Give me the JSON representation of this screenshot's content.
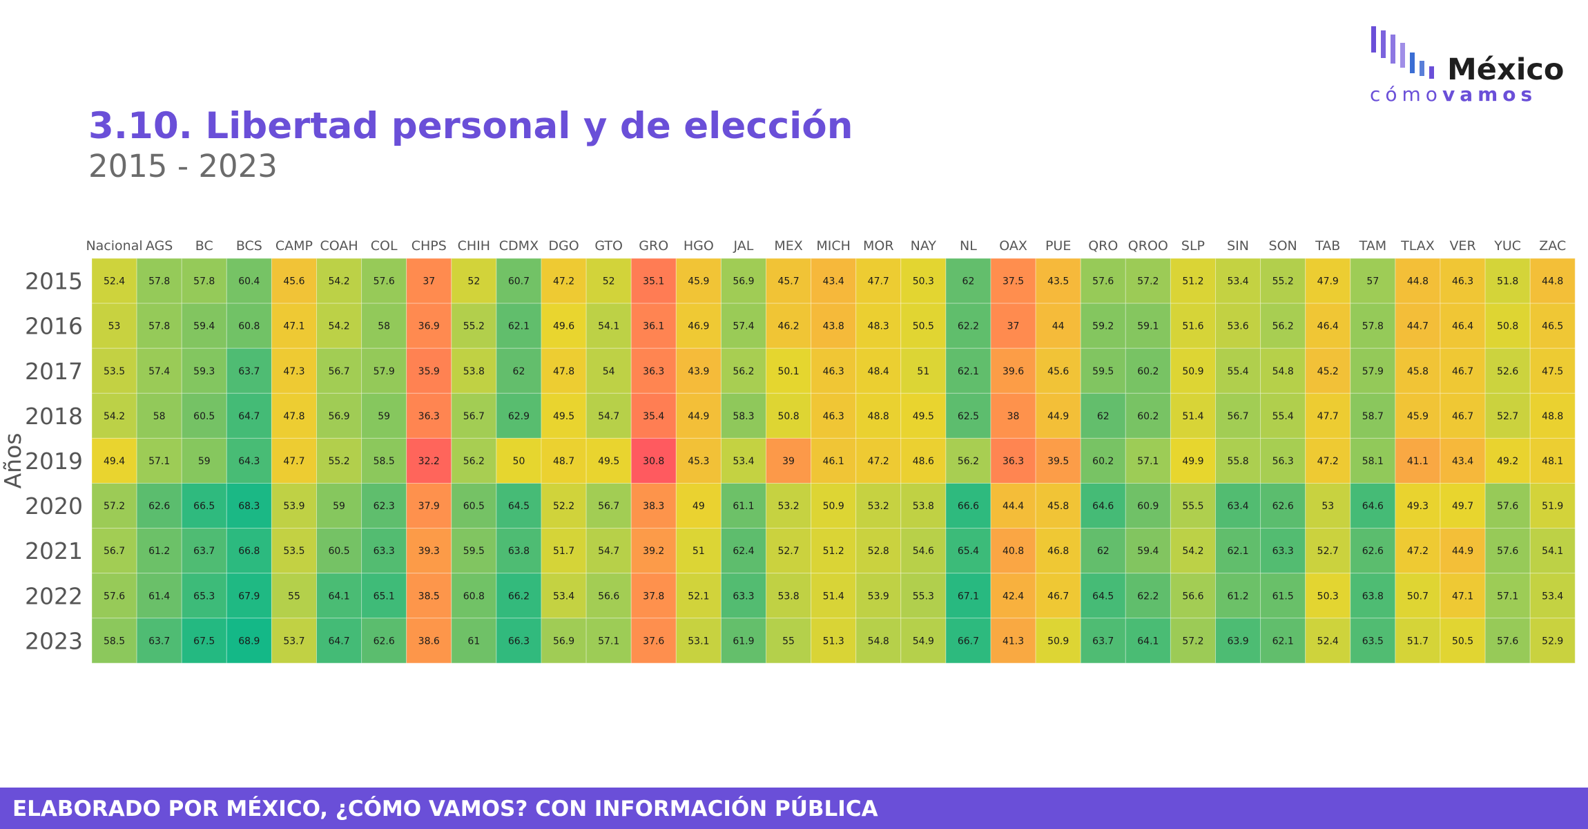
{
  "header": {
    "title": "3.10. Libertad personal y de elección",
    "subtitle": "2015 - 2023"
  },
  "logo": {
    "word": "México",
    "sub_light": "cómo",
    "sub_bold": "vamos",
    "bar_colors": [
      "#6a4fd8",
      "#7b63dd",
      "#8d78e2",
      "#a08ee7",
      "#3b6ed4",
      "#5a7fd8"
    ]
  },
  "footer": {
    "text": "ELABORADO POR MÉXICO, ¿CÓMO VAMOS? CON INFORMACIÓN PÚBLICA",
    "color": "#6a4fd8"
  },
  "chart_data": {
    "type": "heatmap",
    "title": "3.10. Libertad personal y de elección",
    "subtitle": "2015 - 2023",
    "ylabel": "Años",
    "xlabel": "",
    "x": [
      "Nacional",
      "AGS",
      "BC",
      "BCS",
      "CAMP",
      "COAH",
      "COL",
      "CHPS",
      "CHIH",
      "CDMX",
      "DGO",
      "GTO",
      "GRO",
      "HGO",
      "JAL",
      "MEX",
      "MICH",
      "MOR",
      "NAY",
      "NL",
      "OAX",
      "PUE",
      "QRO",
      "QROO",
      "SLP",
      "SIN",
      "SON",
      "TAB",
      "TAM",
      "TLAX",
      "VER",
      "YUC",
      "ZAC"
    ],
    "y": [
      "2015",
      "2016",
      "2017",
      "2018",
      "2019",
      "2020",
      "2021",
      "2022",
      "2023"
    ],
    "values": [
      [
        "52.4",
        "57.8",
        "57.8",
        "60.4",
        "45.6",
        "54.2",
        "57.6",
        "37",
        "52",
        "60.7",
        "47.2",
        "52",
        "35.1",
        "45.9",
        "56.9",
        "45.7",
        "43.4",
        "47.7",
        "50.3",
        "62",
        "37.5",
        "43.5",
        "57.6",
        "57.2",
        "51.2",
        "53.4",
        "55.2",
        "47.9",
        "57",
        "44.8",
        "46.3",
        "51.8",
        "44.8"
      ],
      [
        "53",
        "57.8",
        "59.4",
        "60.8",
        "47.1",
        "54.2",
        "58",
        "36.9",
        "55.2",
        "62.1",
        "49.6",
        "54.1",
        "36.1",
        "46.9",
        "57.4",
        "46.2",
        "43.8",
        "48.3",
        "50.5",
        "62.2",
        "37",
        "44",
        "59.2",
        "59.1",
        "51.6",
        "53.6",
        "56.2",
        "46.4",
        "57.8",
        "44.7",
        "46.4",
        "50.8",
        "46.5"
      ],
      [
        "53.5",
        "57.4",
        "59.3",
        "63.7",
        "47.3",
        "56.7",
        "57.9",
        "35.9",
        "53.8",
        "62",
        "47.8",
        "54",
        "36.3",
        "43.9",
        "56.2",
        "50.1",
        "46.3",
        "48.4",
        "51",
        "62.1",
        "39.6",
        "45.6",
        "59.5",
        "60.2",
        "50.9",
        "55.4",
        "54.8",
        "45.2",
        "57.9",
        "45.8",
        "46.7",
        "52.6",
        "47.5"
      ],
      [
        "54.2",
        "58",
        "60.5",
        "64.7",
        "47.8",
        "56.9",
        "59",
        "36.3",
        "56.7",
        "62.9",
        "49.5",
        "54.7",
        "35.4",
        "44.9",
        "58.3",
        "50.8",
        "46.3",
        "48.8",
        "49.5",
        "62.5",
        "38",
        "44.9",
        "62",
        "60.2",
        "51.4",
        "56.7",
        "55.4",
        "47.7",
        "58.7",
        "45.9",
        "46.7",
        "52.7",
        "48.8"
      ],
      [
        "49.4",
        "57.1",
        "59",
        "64.3",
        "47.7",
        "55.2",
        "58.5",
        "32.2",
        "56.2",
        "50",
        "48.7",
        "49.5",
        "30.8",
        "45.3",
        "53.4",
        "39",
        "46.1",
        "47.2",
        "48.6",
        "56.2",
        "36.3",
        "39.5",
        "60.2",
        "57.1",
        "49.9",
        "55.8",
        "56.3",
        "47.2",
        "58.1",
        "41.1",
        "43.4",
        "49.2",
        "48.1"
      ],
      [
        "57.2",
        "62.6",
        "66.5",
        "68.3",
        "53.9",
        "59",
        "62.3",
        "37.9",
        "60.5",
        "64.5",
        "52.2",
        "56.7",
        "38.3",
        "49",
        "61.1",
        "53.2",
        "50.9",
        "53.2",
        "53.8",
        "66.6",
        "44.4",
        "45.8",
        "64.6",
        "60.9",
        "55.5",
        "63.4",
        "62.6",
        "53",
        "64.6",
        "49.3",
        "49.7",
        "57.6",
        "51.9"
      ],
      [
        "56.7",
        "61.2",
        "63.7",
        "66.8",
        "53.5",
        "60.5",
        "63.3",
        "39.3",
        "59.5",
        "63.8",
        "51.7",
        "54.7",
        "39.2",
        "51",
        "62.4",
        "52.7",
        "51.2",
        "52.8",
        "54.6",
        "65.4",
        "40.8",
        "46.8",
        "62",
        "59.4",
        "54.2",
        "62.1",
        "63.3",
        "52.7",
        "62.6",
        "47.2",
        "44.9",
        "57.6",
        "54.1"
      ],
      [
        "57.6",
        "61.4",
        "65.3",
        "67.9",
        "55",
        "64.1",
        "65.1",
        "38.5",
        "60.8",
        "66.2",
        "53.4",
        "56.6",
        "37.8",
        "52.1",
        "63.3",
        "53.8",
        "51.4",
        "53.9",
        "55.3",
        "67.1",
        "42.4",
        "46.7",
        "64.5",
        "62.2",
        "56.6",
        "61.2",
        "61.5",
        "50.3",
        "63.8",
        "50.7",
        "47.1",
        "57.1",
        "53.4"
      ],
      [
        "58.5",
        "63.7",
        "67.5",
        "68.9",
        "53.7",
        "64.7",
        "62.6",
        "38.6",
        "61",
        "66.3",
        "56.9",
        "57.1",
        "37.6",
        "53.1",
        "61.9",
        "55",
        "51.3",
        "54.8",
        "54.9",
        "66.7",
        "41.3",
        "50.9",
        "63.7",
        "64.1",
        "57.2",
        "63.9",
        "62.1",
        "52.4",
        "63.5",
        "51.7",
        "50.5",
        "57.6",
        "52.9"
      ]
    ],
    "color_scale": {
      "min": 30.8,
      "max": 68.9,
      "stops": [
        "#ff5a5f",
        "#ff8c4f",
        "#f6b93b",
        "#e8d62e",
        "#a8ce52",
        "#5cbd6e",
        "#14b887"
      ]
    },
    "grid": true
  }
}
